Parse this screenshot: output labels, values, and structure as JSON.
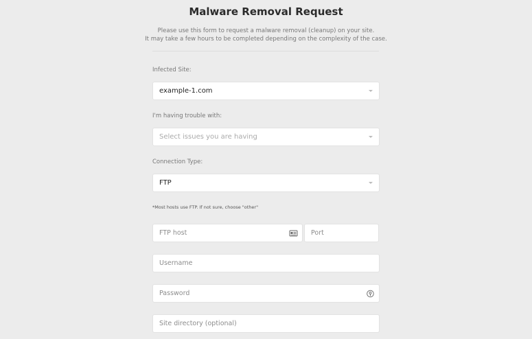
{
  "page": {
    "title": "Malware Removal Request",
    "description_line1": "Please use this form to request a malware removal (cleanup) on your site.",
    "description_line2": "It may take a few hours to be completed depending on the complexity of the case."
  },
  "form": {
    "infected_site": {
      "label": "Infected Site:",
      "value": "example-1.com"
    },
    "trouble": {
      "label": "I'm having trouble with:",
      "placeholder": "Select issues you are having"
    },
    "connection_type": {
      "label": "Connection Type:",
      "value": "FTP"
    },
    "note": "*Most hosts use FTP. If not sure, choose \"other\"",
    "ftp_host": {
      "placeholder": "FTP host",
      "icon": "contact-card-icon"
    },
    "port": {
      "placeholder": "Port"
    },
    "username": {
      "placeholder": "Username"
    },
    "password": {
      "placeholder": "Password",
      "icon": "password-manager-icon"
    },
    "site_directory": {
      "placeholder": "Site directory (optional)"
    }
  }
}
